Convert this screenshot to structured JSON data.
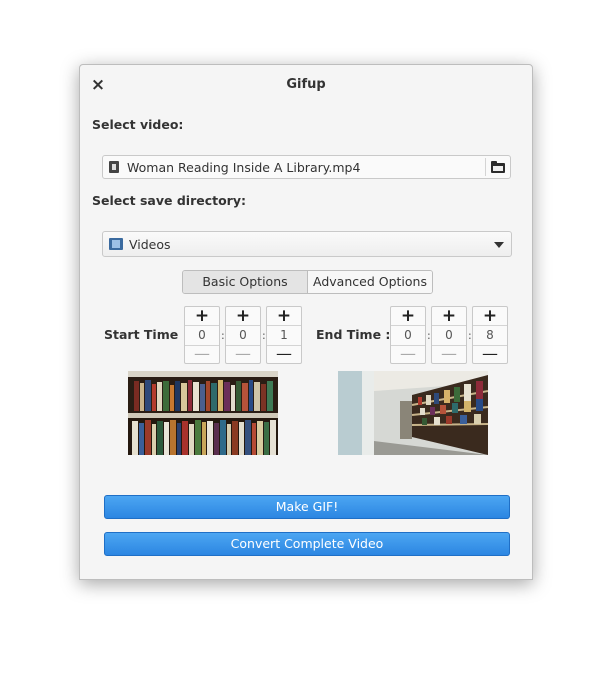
{
  "window": {
    "title": "Gifup",
    "close_glyph": "×"
  },
  "video": {
    "label": "Select video:",
    "filename": "Woman Reading Inside A Library.mp4"
  },
  "save": {
    "label": "Select save directory:",
    "directory": "Videos"
  },
  "tabs": {
    "basic": "Basic Options",
    "advanced": "Advanced Options",
    "active": "Basic Options"
  },
  "start": {
    "label": "Start Time :",
    "h": "0",
    "m": "0",
    "s": "1"
  },
  "end": {
    "label": "End Time :",
    "h": "0",
    "m": "0",
    "s": "8"
  },
  "spin": {
    "plus": "+",
    "minus": "—",
    "sep": ":"
  },
  "buttons": {
    "make_gif": "Make GIF!",
    "convert": "Convert Complete Video"
  },
  "colors": {
    "accent": "#3396e8",
    "window_bg": "#f5f5f5"
  },
  "icons": [
    "close-icon",
    "video-file-icon",
    "folder-open-icon",
    "film-folder-icon",
    "chevron-down-icon"
  ]
}
